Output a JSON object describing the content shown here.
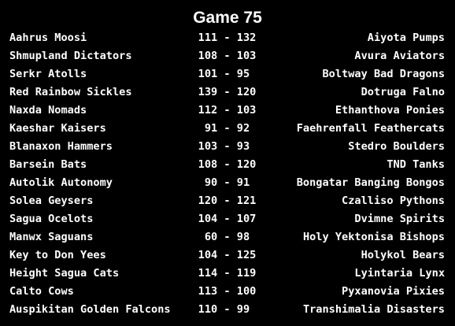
{
  "title": "Game 75",
  "games": [
    {
      "home": "Aahrus Moosi",
      "score": "111 - 132",
      "away": "Aiyota Pumps"
    },
    {
      "home": "Shmupland Dictators",
      "score": "108 - 103",
      "away": "Avura Aviators"
    },
    {
      "home": "Serkr Atolls",
      "score": "101 - 95 ",
      "away": "Boltway Bad Dragons"
    },
    {
      "home": "Red Rainbow Sickles",
      "score": "139 - 120",
      "away": "Dotruga Falno"
    },
    {
      "home": "Naxda Nomads",
      "score": "112 - 103",
      "away": "Ethanthova Ponies"
    },
    {
      "home": "Kaeshar Kaisers",
      "score": " 91 - 92 ",
      "away": "Faehrenfall Feathercats"
    },
    {
      "home": "Blanaxon Hammers",
      "score": "103 - 93 ",
      "away": "Stedro Boulders"
    },
    {
      "home": "Barsein Bats",
      "score": "108 - 120",
      "away": "TND Tanks"
    },
    {
      "home": "Autolik Autonomy",
      "score": " 90 - 91 ",
      "away": "Bongatar Banging Bongos"
    },
    {
      "home": "Solea Geysers",
      "score": "120 - 121",
      "away": "Czalliso Pythons"
    },
    {
      "home": "Sagua Ocelots",
      "score": "104 - 107",
      "away": "Dvimne Spirits"
    },
    {
      "home": "Manwx Saguans",
      "score": " 60 - 98 ",
      "away": "Holy Yektonisa Bishops"
    },
    {
      "home": "Key to Don Yees",
      "score": "104 - 125",
      "away": "Holykol Bears"
    },
    {
      "home": "Height Sagua Cats",
      "score": "114 - 119",
      "away": "Lyintaria Lynx"
    },
    {
      "home": "Calto Cows",
      "score": "113 - 100",
      "away": "Pyxanovia Pixies"
    },
    {
      "home": "Auspikitan Golden Falcons",
      "score": "110 - 99 ",
      "away": "Transhimalia Disasters"
    }
  ]
}
